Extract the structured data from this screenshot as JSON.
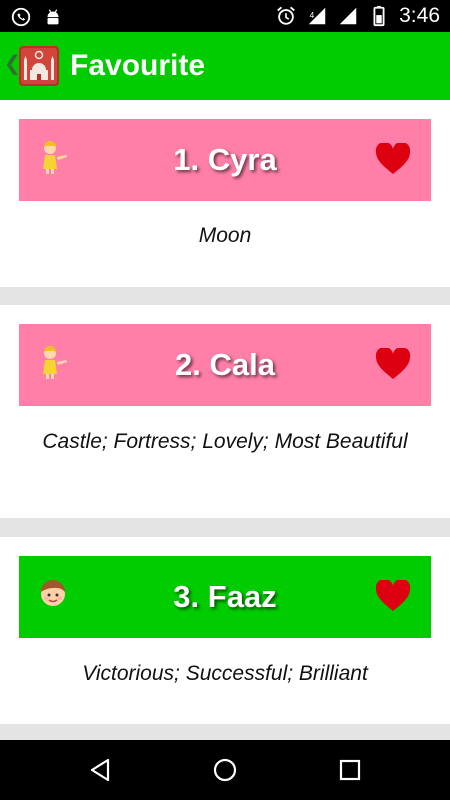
{
  "status_bar": {
    "time": "3:46",
    "left_icons": [
      "whatsapp-icon",
      "android-icon"
    ],
    "right_icons": [
      "alarm-icon",
      "signal-icon",
      "signal-icon-2",
      "battery-icon"
    ]
  },
  "app_bar": {
    "title": "Favourite",
    "back_icon": "back-chevron-icon",
    "logo_icon": "mosque-logo-icon",
    "background": "#00cc00"
  },
  "favourites": [
    {
      "number_name": "1. Cyra",
      "meaning": "Moon",
      "gender": "girl",
      "header_color": "#ff7fa8",
      "favorite": true
    },
    {
      "number_name": "2. Cala",
      "meaning": "Castle; Fortress; Lovely; Most Beautiful",
      "gender": "girl",
      "header_color": "#ff7fa8",
      "favorite": true
    },
    {
      "number_name": "3. Faaz",
      "meaning": "Victorious; Successful; Brilliant",
      "gender": "boy",
      "header_color": "#00cc00",
      "favorite": true
    }
  ],
  "colors": {
    "accent_green": "#00cc00",
    "girl_pink": "#ff7fa8",
    "heart_red": "#dd0011"
  },
  "nav_bar": {
    "buttons": [
      "back-triangle-icon",
      "home-circle-icon",
      "recents-square-icon"
    ]
  }
}
